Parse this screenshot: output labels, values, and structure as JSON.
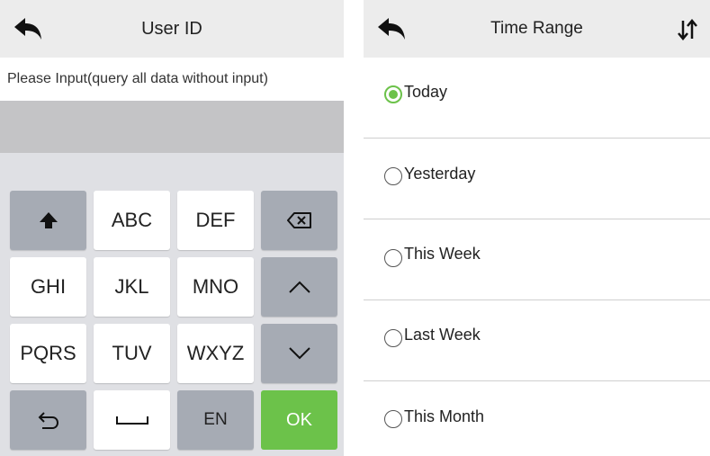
{
  "left_panel": {
    "title": "User ID",
    "back_icon": "back-arrow-icon",
    "prompt": "Please Input(query all data without input)",
    "input_value": "",
    "keyboard": {
      "shift_icon": "shift-arrow-icon",
      "backspace_icon": "backspace-icon",
      "up_icon": "chevron-up-icon",
      "down_icon": "chevron-down-icon",
      "return_icon": "return-icon",
      "space_icon": "space-bar-icon",
      "key_abc": "ABC",
      "key_def": "DEF",
      "key_ghi": "GHI",
      "key_jkl": "JKL",
      "key_mno": "MNO",
      "key_pqrs": "PQRS",
      "key_tuv": "TUV",
      "key_wxyz": "WXYZ",
      "key_en": "EN",
      "key_ok": "OK"
    }
  },
  "right_panel": {
    "title": "Time Range",
    "back_icon": "back-arrow-icon",
    "sort_icon": "sort-icon",
    "options": [
      {
        "label": "Today",
        "selected": true
      },
      {
        "label": "Yesterday",
        "selected": false
      },
      {
        "label": "This Week",
        "selected": false
      },
      {
        "label": "Last Week",
        "selected": false
      },
      {
        "label": "This Month",
        "selected": false
      }
    ]
  },
  "colors": {
    "accent_green": "#6cc24a",
    "topbar": "#ececec",
    "input_background": "#c4c4c6",
    "keyboard_background": "#dfe0e4",
    "function_key": "#a6abb4"
  }
}
